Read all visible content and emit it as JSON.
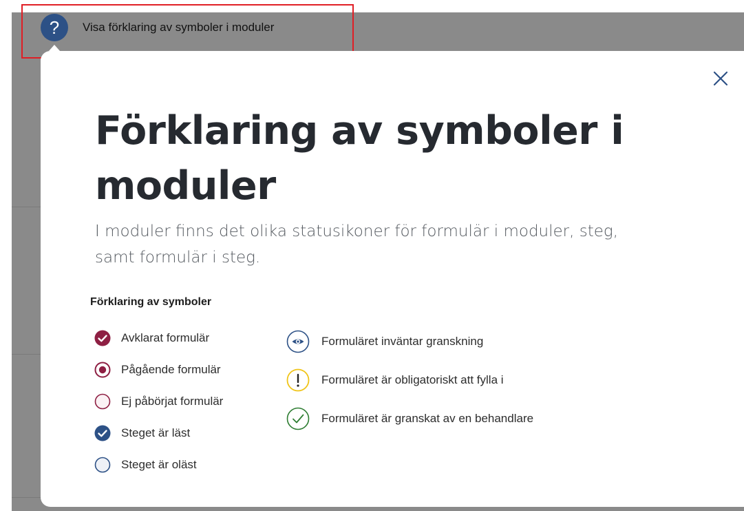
{
  "help_button": {
    "icon_glyph": "?",
    "label": "Visa förklaring av symboler i moduler"
  },
  "modal": {
    "title": "Förklaring av symboler i moduler",
    "intro": "I moduler finns det olika statusikoner för formulär i moduler, steg, samt formulär i steg.",
    "legend_heading": "Förklaring av symboler",
    "legend_left": [
      {
        "icon": "completed-check-icon",
        "label": "Avklarat formulär"
      },
      {
        "icon": "in-progress-dot-icon",
        "label": "Pågående formulär"
      },
      {
        "icon": "not-started-circle-icon",
        "label": "Ej påbörjat formulär"
      },
      {
        "icon": "step-read-check-icon",
        "label": "Steget är läst"
      },
      {
        "icon": "step-unread-circle-icon",
        "label": "Steget är oläst"
      }
    ],
    "legend_right": [
      {
        "icon": "eye-icon",
        "label": "Formuläret inväntar granskning"
      },
      {
        "icon": "exclamation-icon",
        "label": "Formuläret är obligatoriskt att fylla i"
      },
      {
        "icon": "reviewed-check-icon",
        "label": "Formuläret är granskat av en behandlare"
      }
    ]
  },
  "colors": {
    "primary_blue": "#2d5186",
    "burgundy": "#8e1f43",
    "warning_yellow": "#f0c417",
    "success_green": "#2e7d32",
    "overlay_grey": "#8a8a8a",
    "highlight_red": "#e01e25"
  }
}
